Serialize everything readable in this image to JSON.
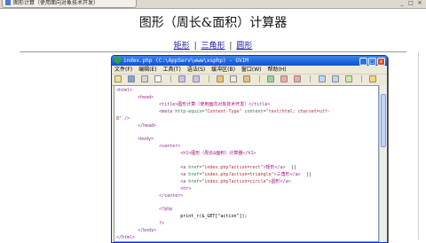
{
  "browser": {
    "tab_title": "图形计算（使用面向对象技术开发）",
    "controls": [
      "_",
      "□",
      "✕"
    ]
  },
  "page": {
    "heading": "图形（周长&面积）计算器",
    "links": [
      "矩形",
      "三角形",
      "圆形"
    ],
    "separator": "|"
  },
  "vim": {
    "title": "index.php (C:\\AppServ\\www\\xsphp) - GVIM",
    "menu": [
      "文件(F)",
      "编辑(E)",
      "工具(T)",
      "语法(S)",
      "缓冲区(B)",
      "窗口(W)",
      "帮助(H)"
    ],
    "lines": [
      [
        {
          "t": "<html>",
          "c": "tag"
        }
      ],
      [
        {
          "t": "        "
        },
        {
          "t": "<head>",
          "c": "tag"
        }
      ],
      [
        {
          "t": "                "
        },
        {
          "t": "<title>",
          "c": "tag"
        },
        {
          "t": "图形计算（使用面向对象技术开发）",
          "c": "txt"
        },
        {
          "t": "</title>",
          "c": "tag"
        }
      ],
      [
        {
          "t": "                "
        },
        {
          "t": "<meta ",
          "c": "tag"
        },
        {
          "t": "http-equiv=",
          "c": "attr"
        },
        {
          "t": "\"Content-Type\" ",
          "c": "str"
        },
        {
          "t": "content=",
          "c": "attr"
        },
        {
          "t": "\"text/html; charset=utf-",
          "c": "str"
        }
      ],
      [
        {
          "t": "8\" ",
          "c": "str"
        },
        {
          "t": "/>",
          "c": "tag"
        }
      ],
      [
        {
          "t": "        "
        },
        {
          "t": "</head>",
          "c": "tag"
        }
      ],
      [
        {
          "t": ""
        }
      ],
      [
        {
          "t": "        "
        },
        {
          "t": "<body>",
          "c": "tag"
        }
      ],
      [
        {
          "t": "                "
        },
        {
          "t": "<center>",
          "c": "tag"
        }
      ],
      [
        {
          "t": "                        "
        },
        {
          "t": "<h1>",
          "c": "tag"
        },
        {
          "t": "图形（周长&面积）计算器",
          "c": "txt"
        },
        {
          "t": "</h1>",
          "c": "tag"
        }
      ],
      [
        {
          "t": ""
        }
      ],
      [
        {
          "t": "                        "
        },
        {
          "t": "<a ",
          "c": "tag"
        },
        {
          "t": "href=",
          "c": "attr"
        },
        {
          "t": "\"index.php?action=rect\"",
          "c": "str"
        },
        {
          "t": ">",
          "c": "tag"
        },
        {
          "t": "矩形",
          "c": "txt"
        },
        {
          "t": "</a>",
          "c": "tag"
        },
        {
          "t": "  ||"
        }
      ],
      [
        {
          "t": "                        "
        },
        {
          "t": "<a ",
          "c": "tag"
        },
        {
          "t": "href=",
          "c": "attr"
        },
        {
          "t": "\"index.php?action=triangle\"",
          "c": "str"
        },
        {
          "t": ">",
          "c": "tag"
        },
        {
          "t": "三角形",
          "c": "txt"
        },
        {
          "t": "</a>",
          "c": "tag"
        },
        {
          "t": "  ||"
        }
      ],
      [
        {
          "t": "                        "
        },
        {
          "t": "<a ",
          "c": "tag"
        },
        {
          "t": "href=",
          "c": "attr"
        },
        {
          "t": "\"index.php?action=circle\"",
          "c": "str"
        },
        {
          "t": ">",
          "c": "tag"
        },
        {
          "t": "圆形",
          "c": "txt"
        },
        {
          "t": "</a>",
          "c": "tag"
        }
      ],
      [
        {
          "t": "                        "
        },
        {
          "t": "<hr>",
          "c": "tag"
        }
      ],
      [
        {
          "t": "                "
        },
        {
          "t": "</center>",
          "c": "tag"
        }
      ],
      [
        {
          "t": ""
        }
      ],
      [
        {
          "t": "                "
        },
        {
          "t": "<?php",
          "c": "tag"
        }
      ],
      [
        {
          "t": "                        print_r($_GET[\"action\"]);"
        }
      ],
      [
        {
          "t": "                "
        },
        {
          "t": "?>",
          "c": "tag"
        }
      ],
      [
        {
          "t": "        "
        },
        {
          "t": "</body>",
          "c": "tag"
        }
      ],
      [
        {
          "t": "</html>",
          "c": "tag"
        }
      ]
    ]
  }
}
